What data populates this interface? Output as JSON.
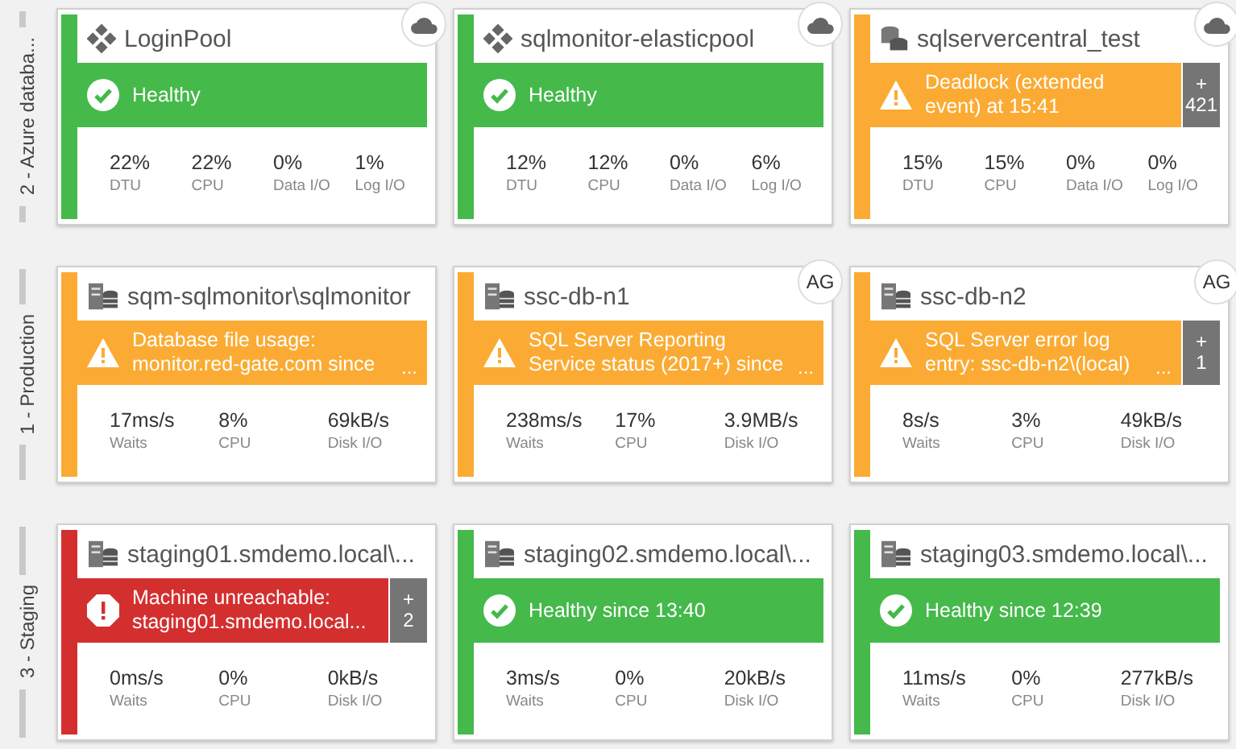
{
  "groups": [
    {
      "label": "2 - Azure databa...",
      "cards": [
        {
          "title": "LoginPool",
          "kind": "pool",
          "badge": {
            "kind": "cloud"
          },
          "banner": {
            "kind": "healthy",
            "lines": [
              "Healthy"
            ]
          },
          "metrics": [
            {
              "value": "22%",
              "label": "DTU"
            },
            {
              "value": "22%",
              "label": "CPU"
            },
            {
              "value": "0%",
              "label": "Data I/O"
            },
            {
              "value": "1%",
              "label": "Log I/O"
            }
          ]
        },
        {
          "title": "sqlmonitor-elasticpool",
          "kind": "pool",
          "badge": {
            "kind": "cloud"
          },
          "banner": {
            "kind": "healthy",
            "lines": [
              "Healthy"
            ]
          },
          "metrics": [
            {
              "value": "12%",
              "label": "DTU"
            },
            {
              "value": "12%",
              "label": "CPU"
            },
            {
              "value": "0%",
              "label": "Data I/O"
            },
            {
              "value": "6%",
              "label": "Log I/O"
            }
          ]
        },
        {
          "title": "sqlservercentral_test",
          "kind": "database",
          "badge": {
            "kind": "cloud"
          },
          "banner": {
            "kind": "warning",
            "lines": [
              "Deadlock (extended",
              "event) at 15:41"
            ],
            "more": {
              "sign": "+",
              "count": "421"
            }
          },
          "metrics": [
            {
              "value": "15%",
              "label": "DTU"
            },
            {
              "value": "15%",
              "label": "CPU"
            },
            {
              "value": "0%",
              "label": "Data I/O"
            },
            {
              "value": "0%",
              "label": "Log I/O"
            }
          ]
        }
      ]
    },
    {
      "label": "1 - Production",
      "cards": [
        {
          "title": "sqm-sqlmonitor\\sqlmonitor",
          "kind": "server",
          "banner": {
            "kind": "warning",
            "lines": [
              "Database file usage:",
              "monitor.red-gate.com since"
            ],
            "overflow": "..."
          },
          "metrics": [
            {
              "value": "17ms/s",
              "label": "Waits"
            },
            {
              "value": "8%",
              "label": "CPU"
            },
            {
              "value": "69kB/s",
              "label": "Disk I/O"
            }
          ]
        },
        {
          "title": "ssc-db-n1",
          "kind": "server",
          "badge": {
            "kind": "text",
            "text": "AG"
          },
          "banner": {
            "kind": "warning",
            "lines": [
              "SQL Server Reporting",
              "Service status (2017+) since"
            ],
            "overflow": "..."
          },
          "metrics": [
            {
              "value": "238ms/s",
              "label": "Waits"
            },
            {
              "value": "17%",
              "label": "CPU"
            },
            {
              "value": "3.9MB/s",
              "label": "Disk I/O"
            }
          ]
        },
        {
          "title": "ssc-db-n2",
          "kind": "server",
          "badge": {
            "kind": "text",
            "text": "AG"
          },
          "banner": {
            "kind": "warning",
            "lines": [
              "SQL Server error log",
              "entry: ssc-db-n2\\(local)"
            ],
            "overflow": "...",
            "more": {
              "sign": "+",
              "count": "1"
            }
          },
          "metrics": [
            {
              "value": "8s/s",
              "label": "Waits"
            },
            {
              "value": "3%",
              "label": "CPU"
            },
            {
              "value": "49kB/s",
              "label": "Disk I/O"
            }
          ]
        }
      ]
    },
    {
      "label": "3 - Staging",
      "cards": [
        {
          "title": "staging01.smdemo.local\\...",
          "kind": "server",
          "banner": {
            "kind": "error",
            "lines": [
              "Machine unreachable:",
              "staging01.smdemo.local..."
            ],
            "more": {
              "sign": "+",
              "count": "2"
            }
          },
          "metrics": [
            {
              "value": "0ms/s",
              "label": "Waits"
            },
            {
              "value": "0%",
              "label": "CPU"
            },
            {
              "value": "0kB/s",
              "label": "Disk I/O"
            }
          ]
        },
        {
          "title": "staging02.smdemo.local\\...",
          "kind": "server",
          "banner": {
            "kind": "healthy",
            "lines": [
              "Healthy since 13:40"
            ]
          },
          "metrics": [
            {
              "value": "3ms/s",
              "label": "Waits"
            },
            {
              "value": "0%",
              "label": "CPU"
            },
            {
              "value": "20kB/s",
              "label": "Disk I/O"
            }
          ]
        },
        {
          "title": "staging03.smdemo.local\\...",
          "kind": "server",
          "banner": {
            "kind": "healthy",
            "lines": [
              "Healthy since 12:39"
            ]
          },
          "metrics": [
            {
              "value": "11ms/s",
              "label": "Waits"
            },
            {
              "value": "0%",
              "label": "CPU"
            },
            {
              "value": "277kB/s",
              "label": "Disk I/O"
            }
          ]
        }
      ]
    }
  ]
}
